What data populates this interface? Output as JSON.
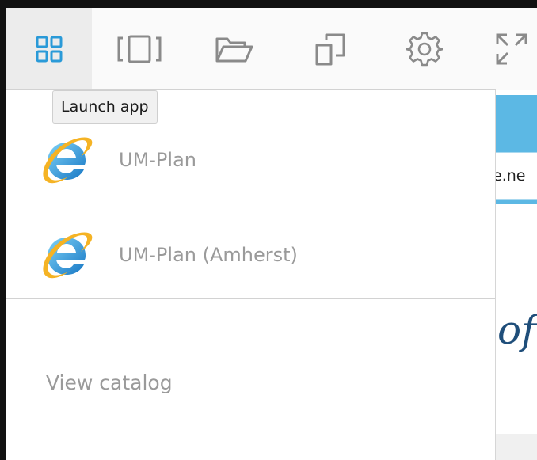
{
  "toolbar": {
    "tools": [
      {
        "icon": "grid-apps-icon",
        "active": true
      },
      {
        "icon": "desktop-window-icon"
      },
      {
        "icon": "folder-open-icon"
      },
      {
        "icon": "copy-windows-icon"
      },
      {
        "icon": "gear-icon"
      },
      {
        "icon": "fullscreen-expand-icon"
      }
    ],
    "tooltip": "Launch app"
  },
  "menu": {
    "apps": [
      {
        "label": "UM-Plan",
        "icon": "internet-explorer-icon"
      },
      {
        "label": "UM-Plan (Amherst)",
        "icon": "internet-explorer-icon"
      }
    ],
    "catalog_label": "View catalog"
  },
  "background_page": {
    "url_fragment": "e.ne",
    "heading_fragment": "of"
  },
  "colors": {
    "accent_blue": "#2a9ad8",
    "icon_gray": "#8a8a8a",
    "muted_text": "#9a9a9a",
    "band_blue": "#5cb8e4"
  }
}
